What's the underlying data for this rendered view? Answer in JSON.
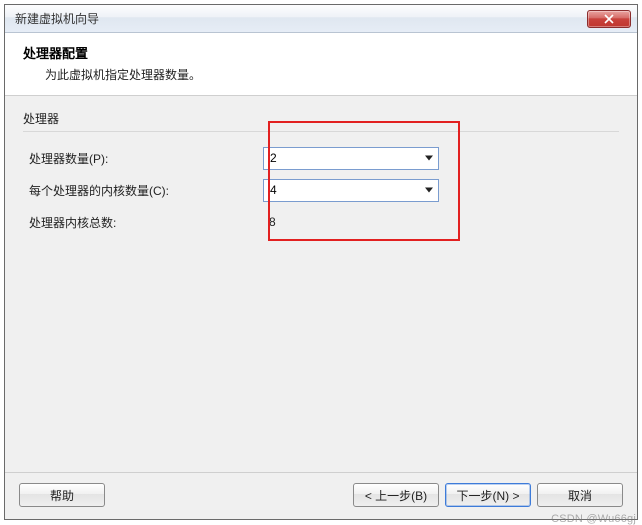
{
  "window": {
    "title": "新建虚拟机向导"
  },
  "header": {
    "title": "处理器配置",
    "subtitle": "为此虚拟机指定处理器数量。"
  },
  "group_label": "处理器",
  "fields": {
    "processor_count": {
      "label": "处理器数量(P):",
      "value": "2"
    },
    "cores_per_proc": {
      "label": "每个处理器的内核数量(C):",
      "value": "4"
    },
    "total_cores": {
      "label": "处理器内核总数:",
      "value": "8"
    }
  },
  "buttons": {
    "help": "帮助",
    "back": "< 上一步(B)",
    "next": "下一步(N) >",
    "cancel": "取消"
  },
  "watermark": "CSDN @Wu66gj"
}
